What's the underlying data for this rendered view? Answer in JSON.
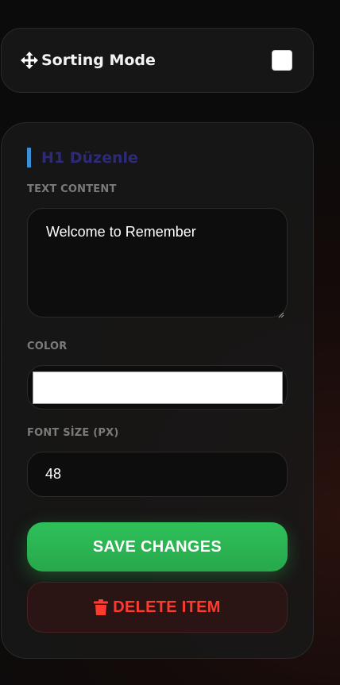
{
  "sorting": {
    "label": "Sorting Mode",
    "icon": "move-arrows-icon",
    "checked": false
  },
  "editor": {
    "title": "H1 Düzenle",
    "title_accent": "#3b8fd6",
    "text_label": "TEXT CONTENT",
    "text_value": "Welcome to Remember",
    "color_label": "COLOR",
    "color_value": "#ffffff",
    "font_size_label": "FONT SİZE (PX)",
    "font_size_value": "48",
    "save_label": "SAVE CHANGES",
    "save_color": "#2fc05a",
    "delete_label": "DELETE ITEM",
    "delete_icon": "trash-icon",
    "delete_color": "#ff3b30"
  }
}
